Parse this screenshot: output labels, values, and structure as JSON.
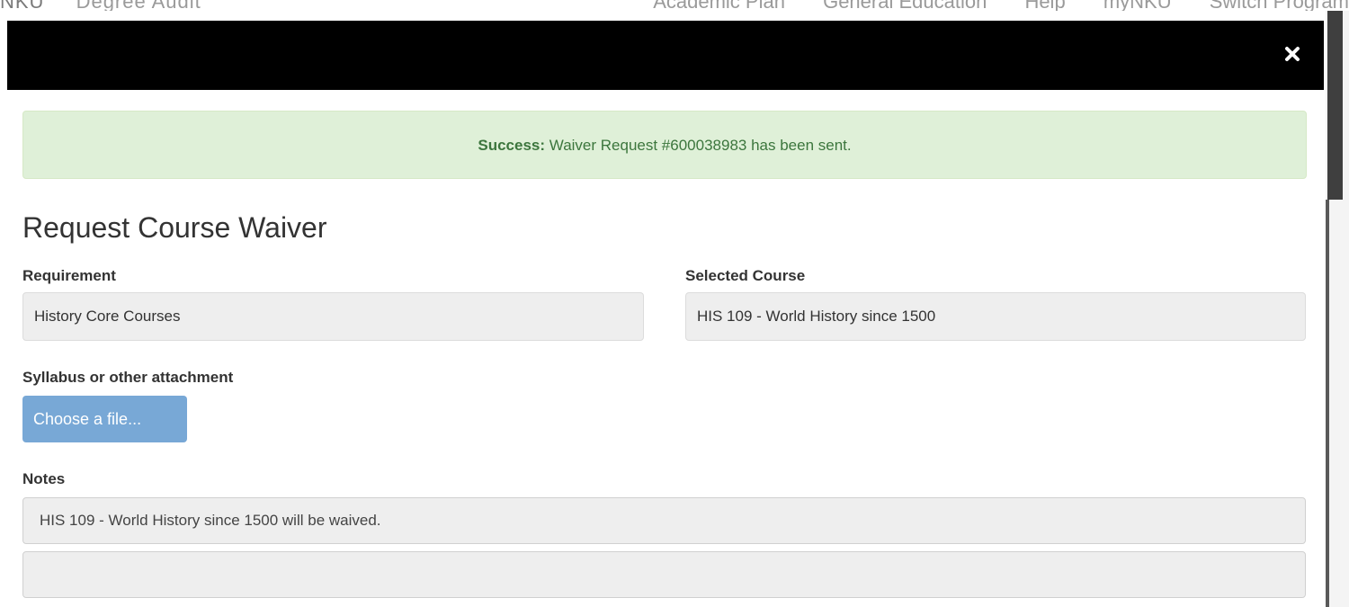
{
  "background_nav": {
    "brand_mark": "NKU",
    "brand_title": "Degree Audit",
    "links": [
      "Academic Plan",
      "General Education",
      "Help",
      "myNKU",
      "Switch Program"
    ]
  },
  "modal": {
    "close_icon": "close-icon",
    "alert": {
      "strong": "Success:",
      "message": "Waiver Request #600038983 has been sent."
    },
    "title": "Request Course Waiver",
    "requirement": {
      "label": "Requirement",
      "value": "History Core Courses"
    },
    "selected_course": {
      "label": "Selected Course",
      "value": "HIS 109 - World History since 1500"
    },
    "attachment": {
      "label": "Syllabus or other attachment",
      "button_label": "Choose a file..."
    },
    "notes": {
      "label": "Notes",
      "existing_note": "HIS 109 - World History since 1500 will be waived.",
      "new_note": ""
    }
  },
  "colors": {
    "header_bg": "#000000",
    "alert_bg": "#dff0d8",
    "alert_text": "#3c763d",
    "file_button": "#78a8d6"
  }
}
